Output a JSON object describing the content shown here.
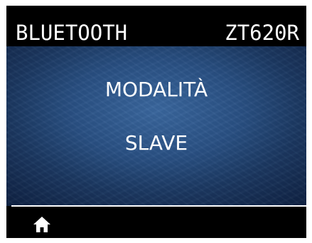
{
  "header": {
    "title": "BLUETOOTH",
    "model": "ZT620R"
  },
  "content": {
    "setting_name": "MODALITÀ",
    "setting_value": "SLAVE"
  },
  "footer": {
    "home_icon": "home-icon"
  },
  "colors": {
    "background": "#000000",
    "panel_center": "#3a679e",
    "panel_edge": "#0f2344",
    "text": "#ffffff"
  }
}
